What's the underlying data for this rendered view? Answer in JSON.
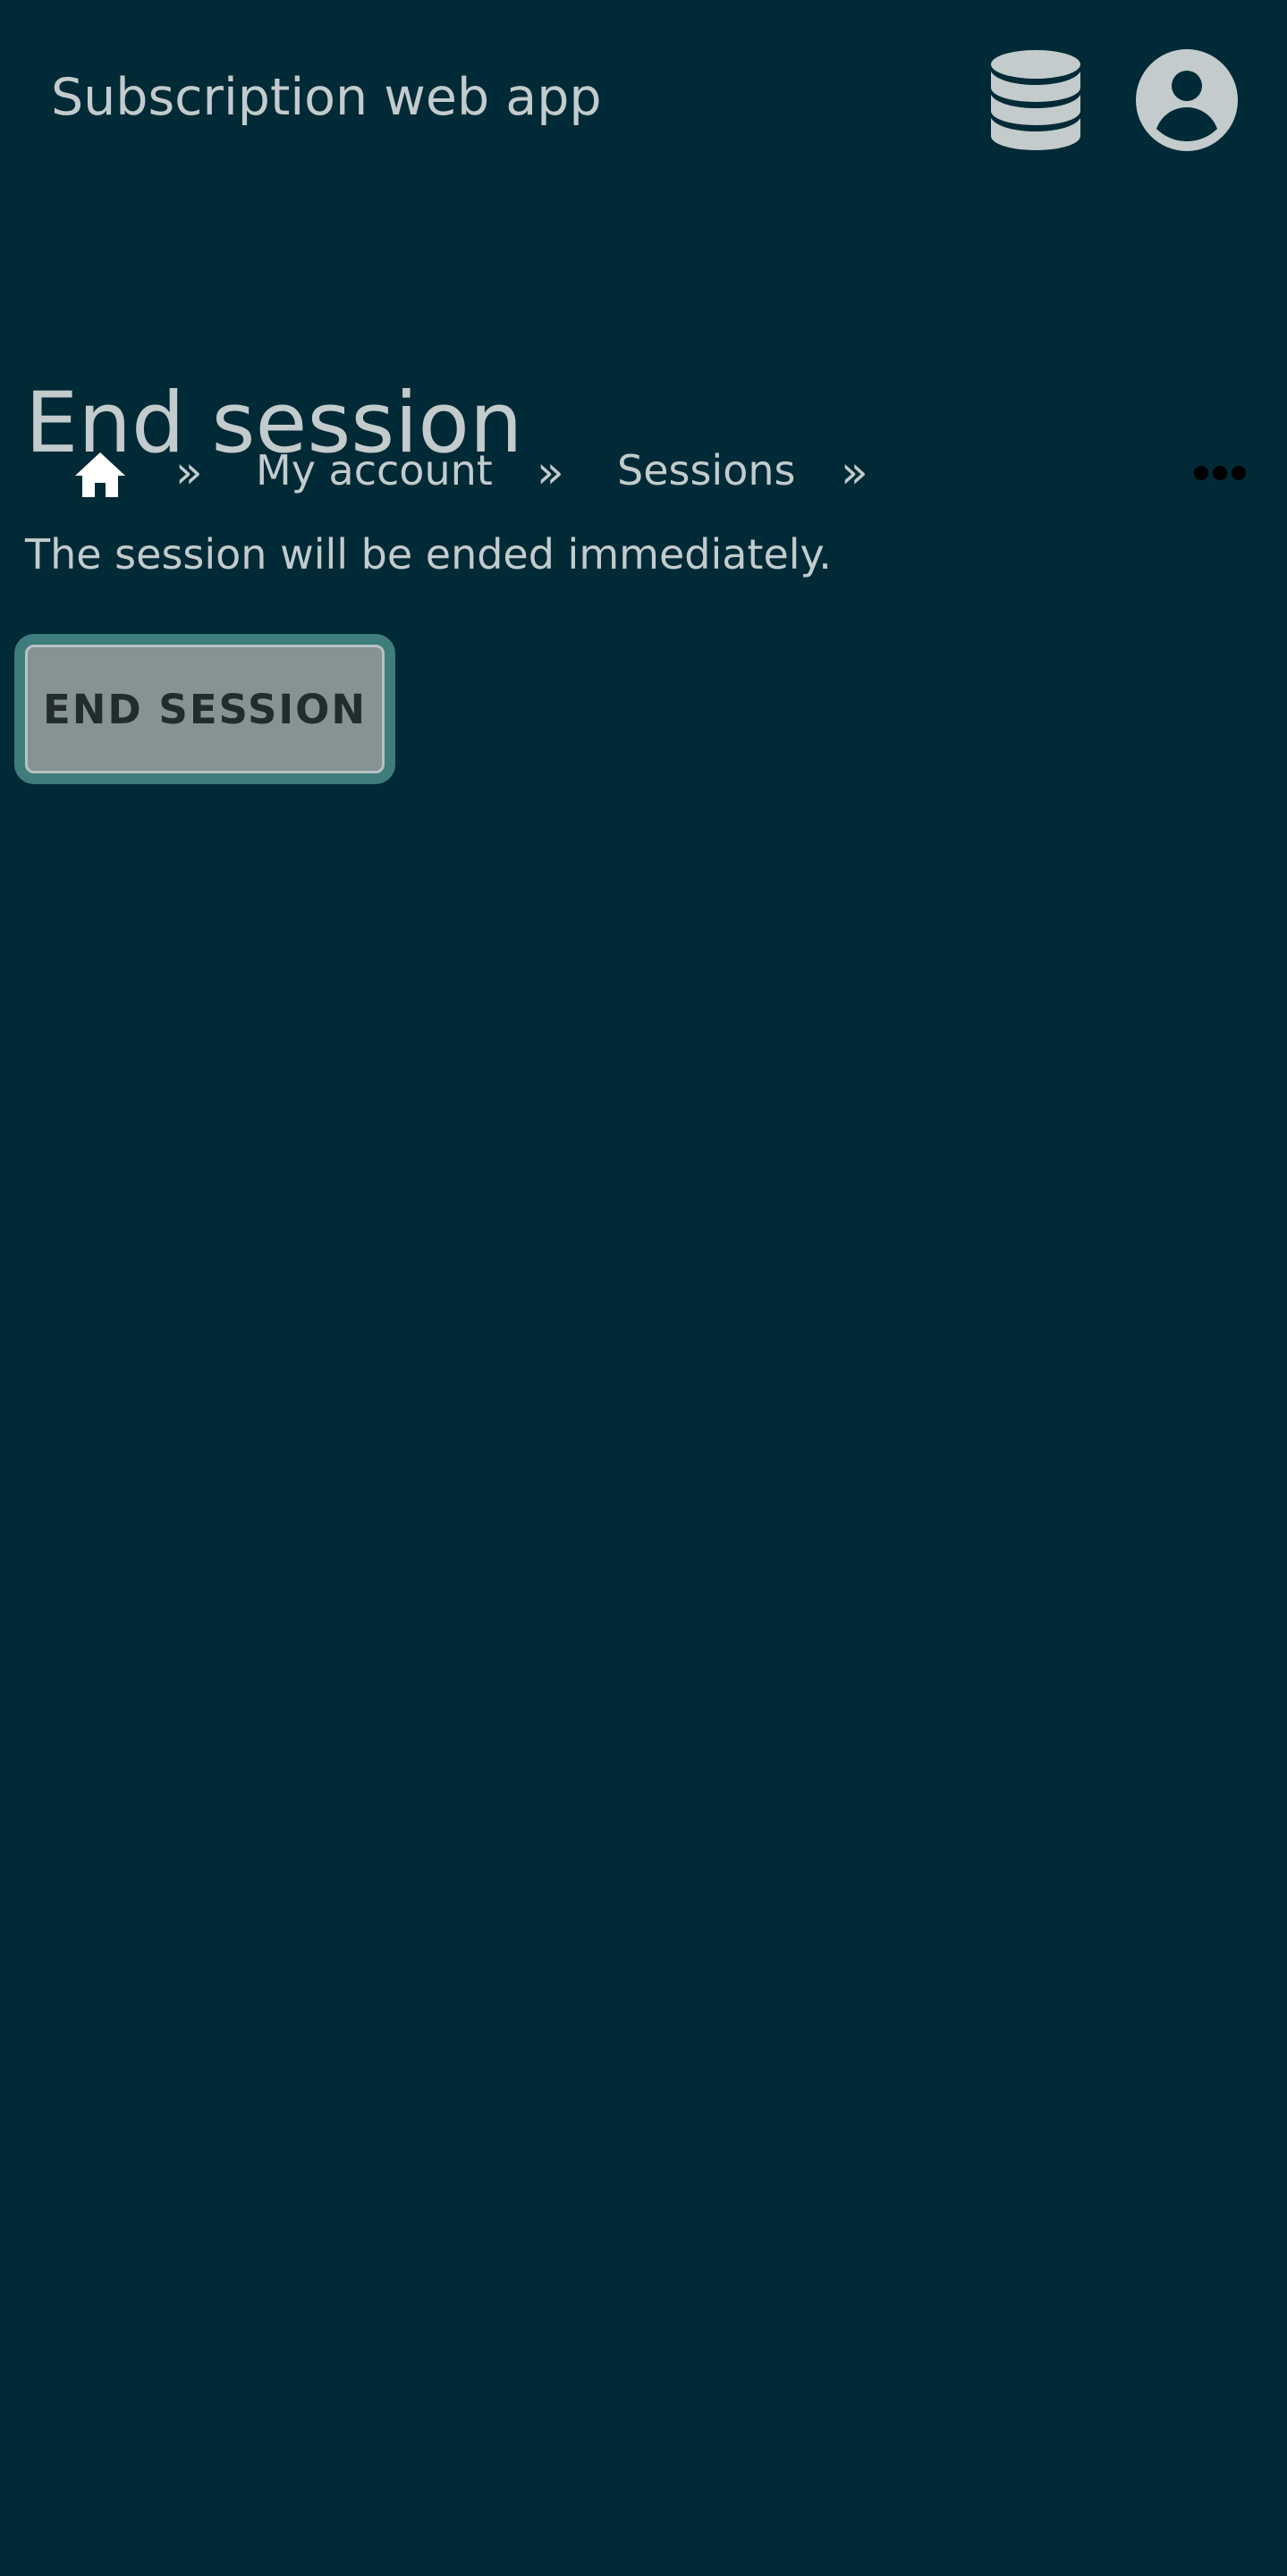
{
  "header": {
    "app_title": "Subscription web app",
    "icons": {
      "database": "database-icon",
      "user": "user-account-icon"
    }
  },
  "breadcrumb": {
    "home_icon": "home-icon",
    "separator": "»",
    "items": [
      {
        "label": "My account"
      },
      {
        "label": "Sessions"
      }
    ],
    "more_icon": "more-options-icon"
  },
  "main": {
    "title": "End session",
    "description": "The session will be ended immediately.",
    "end_button_label": "END SESSION"
  },
  "colors": {
    "background": "#002a36",
    "text": "#c3cbcd",
    "button_fill": "#859394",
    "button_border": "#3f7c7c",
    "button_text": "#222b2d"
  }
}
